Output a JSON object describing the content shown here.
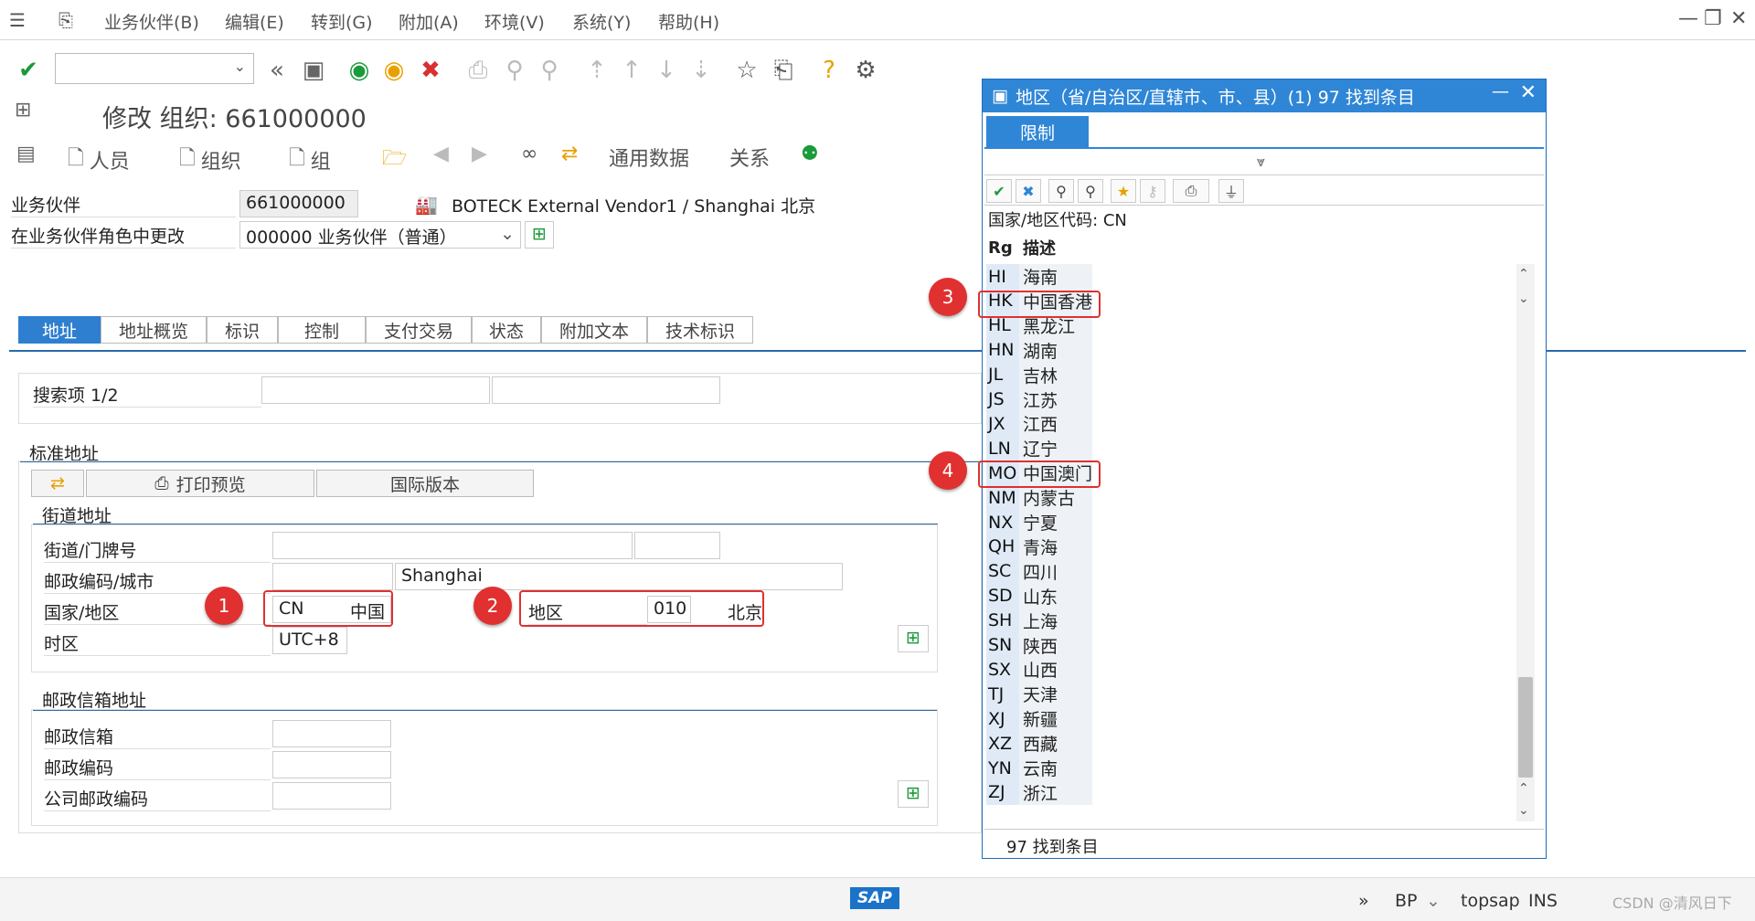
{
  "menu": {
    "items": [
      "业务伙伴(B)",
      "编辑(E)",
      "转到(G)",
      "附加(A)",
      "环境(V)",
      "系统(Y)",
      "帮助(H)"
    ]
  },
  "title": "修改 组织: 661000000",
  "app_toolbar": {
    "person": "人员",
    "org": "组织",
    "group": "组",
    "general_data": "通用数据",
    "relations": "关系"
  },
  "header": {
    "bp_label": "业务伙伴",
    "bp_value": "661000000",
    "bp_desc": "BOTECK External Vendor1 / Shanghai 北京",
    "role_label": "在业务伙伴角色中更改",
    "role_value": "000000 业务伙伴（普通）"
  },
  "tabs": [
    "地址",
    "地址概览",
    "标识",
    "控制",
    "支付交易",
    "状态",
    "附加文本",
    "技术标识"
  ],
  "search": {
    "label": "搜索项 1/2"
  },
  "std_address": {
    "title": "标准地址",
    "print_preview": "打印预览",
    "intl_version": "国际版本",
    "street_section": "街道地址",
    "street_label": "街道/门牌号",
    "postal_label": "邮政编码/城市",
    "city_value": "Shanghai",
    "country_label": "国家/地区",
    "country_code": "CN",
    "country_name": "中国",
    "region_label": "地区",
    "region_code": "010",
    "region_name": "北京",
    "tz_label": "时区",
    "tz_value": "UTC+8"
  },
  "pobox": {
    "title": "邮政信箱地址",
    "pobox_label": "邮政信箱",
    "postal_label": "邮政编码",
    "company_label": "公司邮政编码"
  },
  "badges": [
    "1",
    "2",
    "3",
    "4"
  ],
  "popup": {
    "title": "地区（省/自治区/直辖市、市、县）(1)  97 找到条目",
    "tab": "限制",
    "filter": "国家/地区代码: CN",
    "col_code": "Rg",
    "col_desc": "描述",
    "rows": [
      {
        "code": "HI",
        "desc": "海南"
      },
      {
        "code": "HK",
        "desc": "中国香港"
      },
      {
        "code": "HL",
        "desc": "黑龙江"
      },
      {
        "code": "HN",
        "desc": "湖南"
      },
      {
        "code": "JL",
        "desc": "吉林"
      },
      {
        "code": "JS",
        "desc": "江苏"
      },
      {
        "code": "JX",
        "desc": "江西"
      },
      {
        "code": "LN",
        "desc": "辽宁"
      },
      {
        "code": "MO",
        "desc": "中国澳门"
      },
      {
        "code": "NM",
        "desc": "内蒙古"
      },
      {
        "code": "NX",
        "desc": "宁夏"
      },
      {
        "code": "QH",
        "desc": "青海"
      },
      {
        "code": "SC",
        "desc": "四川"
      },
      {
        "code": "SD",
        "desc": "山东"
      },
      {
        "code": "SH",
        "desc": "上海"
      },
      {
        "code": "SN",
        "desc": "陕西"
      },
      {
        "code": "SX",
        "desc": "山西"
      },
      {
        "code": "TJ",
        "desc": "天津"
      },
      {
        "code": "XJ",
        "desc": "新疆"
      },
      {
        "code": "XZ",
        "desc": "西藏"
      },
      {
        "code": "YN",
        "desc": "云南"
      },
      {
        "code": "ZJ",
        "desc": "浙江"
      }
    ],
    "footer": "97 找到条目"
  },
  "statusbar": {
    "logo": "SAP",
    "tx": "BP",
    "system": "topsap",
    "mode": "INS",
    "watermark": "CSDN @清风日下"
  },
  "colors": {
    "accent": "#2f86d6",
    "highlight": "#e03030"
  }
}
